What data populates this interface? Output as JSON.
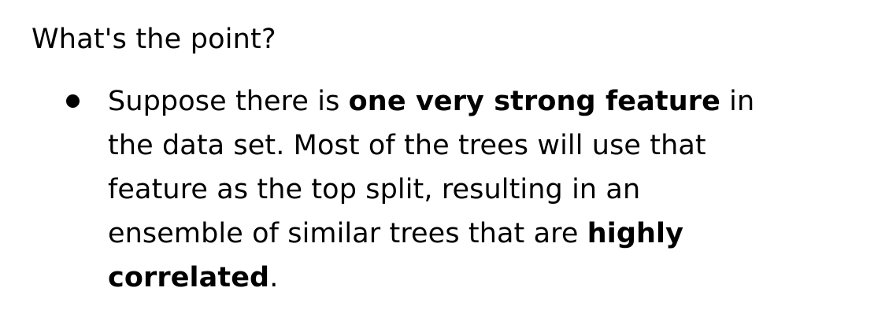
{
  "heading": "What's the point?",
  "bullet": {
    "lines": [
      [
        {
          "text": "Suppose there is ",
          "bold": false
        },
        {
          "text": "one very strong feature",
          "bold": true
        },
        {
          "text": " in",
          "bold": false
        }
      ],
      [
        {
          "text": "the data set. Most of the trees will use that",
          "bold": false
        }
      ],
      [
        {
          "text": "feature as the top split, resulting in an",
          "bold": false
        }
      ],
      [
        {
          "text": "ensemble of similar trees that are ",
          "bold": false
        },
        {
          "text": "highly",
          "bold": true
        }
      ],
      [
        {
          "text": "correlated",
          "bold": true
        },
        {
          "text": ".",
          "bold": false
        }
      ]
    ]
  }
}
